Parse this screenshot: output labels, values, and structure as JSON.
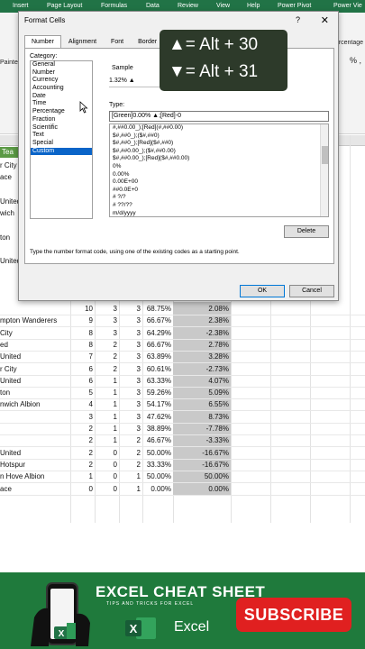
{
  "ribbon": {
    "tabs": [
      "Insert",
      "Page Layout",
      "Formulas",
      "Data",
      "Review",
      "View",
      "Help",
      "Power Pivot",
      "Power Vie"
    ],
    "left_label": "Painte",
    "right_label": "ercentage",
    "right_label2": "% ,"
  },
  "sheet": {
    "partial_names_top": [
      "r City",
      "ace",
      "United",
      "wich",
      "ton",
      "United"
    ],
    "header_fragment": "Tea",
    "rows": [
      {
        "name": "",
        "a": "10",
        "b": "3",
        "c": "3",
        "pct": "68.75%",
        "chg": "2.08%"
      },
      {
        "name": "mpton Wanderers",
        "a": "9",
        "b": "3",
        "c": "3",
        "pct": "66.67%",
        "chg": "2.38%"
      },
      {
        "name": "City",
        "a": "8",
        "b": "3",
        "c": "3",
        "pct": "64.29%",
        "chg": "-2.38%"
      },
      {
        "name": "ed",
        "a": "8",
        "b": "2",
        "c": "3",
        "pct": "66.67%",
        "chg": "2.78%"
      },
      {
        "name": "United",
        "a": "7",
        "b": "2",
        "c": "3",
        "pct": "63.89%",
        "chg": "3.28%"
      },
      {
        "name": "r City",
        "a": "6",
        "b": "2",
        "c": "3",
        "pct": "60.61%",
        "chg": "-2.73%"
      },
      {
        "name": "United",
        "a": "6",
        "b": "1",
        "c": "3",
        "pct": "63.33%",
        "chg": "4.07%"
      },
      {
        "name": "ton",
        "a": "5",
        "b": "1",
        "c": "3",
        "pct": "59.26%",
        "chg": "5.09%"
      },
      {
        "name": "nwich Albion",
        "a": "4",
        "b": "1",
        "c": "3",
        "pct": "54.17%",
        "chg": "6.55%"
      },
      {
        "name": "",
        "a": "3",
        "b": "1",
        "c": "3",
        "pct": "47.62%",
        "chg": "8.73%"
      },
      {
        "name": "",
        "a": "2",
        "b": "1",
        "c": "3",
        "pct": "38.89%",
        "chg": "-7.78%"
      },
      {
        "name": "",
        "a": "2",
        "b": "1",
        "c": "2",
        "pct": "46.67%",
        "chg": "-3.33%"
      },
      {
        "name": "United",
        "a": "2",
        "b": "0",
        "c": "2",
        "pct": "50.00%",
        "chg": "-16.67%"
      },
      {
        "name": "Hotspur",
        "a": "2",
        "b": "0",
        "c": "2",
        "pct": "33.33%",
        "chg": "-16.67%"
      },
      {
        "name": "n Hove Albion",
        "a": "1",
        "b": "0",
        "c": "1",
        "pct": "50.00%",
        "chg": "50.00%"
      },
      {
        "name": "ace",
        "a": "0",
        "b": "0",
        "c": "1",
        "pct": "0.00%",
        "chg": "0.00%"
      }
    ]
  },
  "dialog": {
    "title": "Format Cells",
    "help": "?",
    "close": "✕",
    "tabs": [
      "Number",
      "Alignment",
      "Font",
      "Border"
    ],
    "category_label": "Category:",
    "categories": [
      "General",
      "Number",
      "Currency",
      "Accounting",
      "Date",
      "Time",
      "Percentage",
      "Fraction",
      "Scientific",
      "Text",
      "Special",
      "Custom"
    ],
    "selected_category": "Custom",
    "sample_label": "Sample",
    "sample_value": "1.32% ▲",
    "type_label": "Type:",
    "type_value": "[Green]0.00% ▲;[Red]-0",
    "formats": [
      "#,##0.00_);[Red](#,##0.00)",
      "$#,##0_);($#,##0)",
      "$#,##0_);[Red]($#,##0)",
      "$#,##0.00_);($#,##0.00)",
      "$#,##0.00_);[Red]($#,##0.00)",
      "0%",
      "0.00%",
      "0.00E+00",
      "##0.0E+0",
      "# ?/?",
      "# ??/??",
      "m/d/yyyy"
    ],
    "delete_label": "Delete",
    "hint": "Type the number format code, using one of the existing codes as a starting point.",
    "ok_label": "OK",
    "cancel_label": "Cancel"
  },
  "overlay": {
    "line1": "▲= Alt + 30",
    "line2": "▼= Alt + 31"
  },
  "banner": {
    "title": "EXCEL CHEAT SHEET",
    "tagline": "TIPS AND TRICKS FOR EXCEL",
    "excel_word": "Excel",
    "subscribe_label": "SUBSCRIBE",
    "colors": {
      "banner": "#1f7a3c",
      "subscribe": "#e02020",
      "excel_green": "#217346"
    }
  }
}
